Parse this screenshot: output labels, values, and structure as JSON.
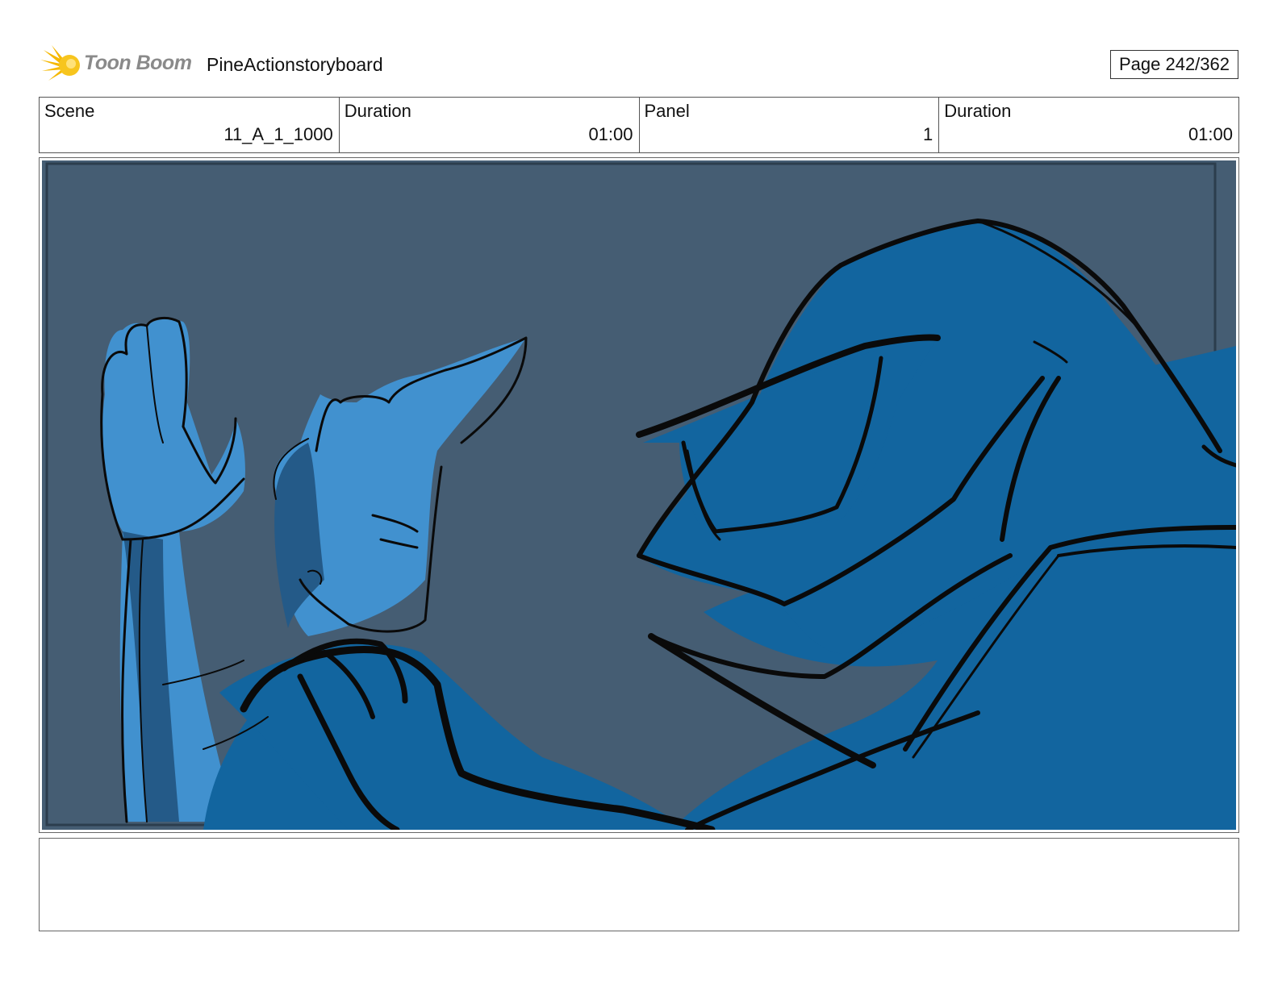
{
  "header": {
    "logo_text": "Toon Boom",
    "project_title": "PineActionstoryboard",
    "page_label": "Page 242/362"
  },
  "info": {
    "scene_label": "Scene",
    "scene_value": "11_A_1_1000",
    "scene_duration_label": "Duration",
    "scene_duration_value": "01:00",
    "panel_label": "Panel",
    "panel_value": "1",
    "panel_duration_label": "Duration",
    "panel_duration_value": "01:00"
  },
  "colors": {
    "background": "#455d73",
    "character_light": "#4191cf",
    "character_shadow": "#245a88",
    "robot_blue": "#12659f",
    "ink": "#0a0a0a"
  },
  "notes": {
    "text": ""
  }
}
